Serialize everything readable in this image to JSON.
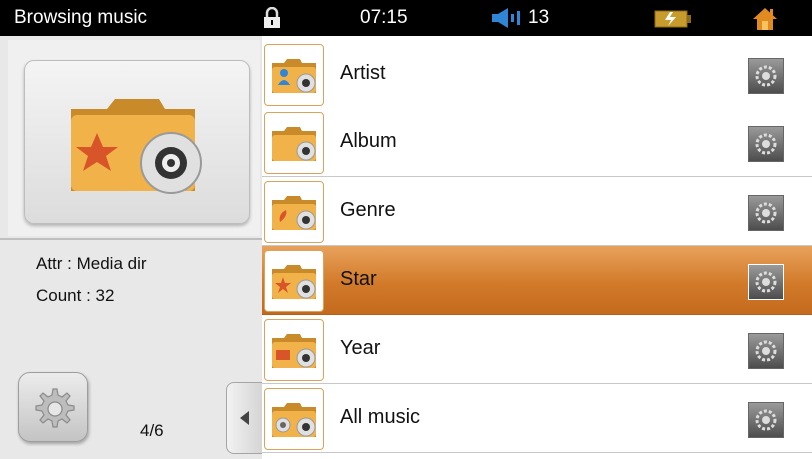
{
  "status_bar": {
    "title": "Browsing music",
    "time": "07:15",
    "volume": "13",
    "icons": [
      "lock-icon",
      "speaker-icon",
      "battery-icon",
      "home-icon"
    ]
  },
  "sidebar": {
    "attr": "Attr : Media dir",
    "count": "Count : 32",
    "page": "4/6",
    "art_icon": "star-music-folder-icon"
  },
  "list": {
    "items": [
      {
        "label": "Artist",
        "icon": "artist-folder-icon"
      },
      {
        "label": "Album",
        "icon": "album-folder-icon"
      },
      {
        "label": "Genre",
        "icon": "genre-folder-icon"
      },
      {
        "label": "Star",
        "icon": "star-folder-icon",
        "selected": true
      },
      {
        "label": "Year",
        "icon": "year-folder-icon"
      },
      {
        "label": "All music",
        "icon": "all-music-folder-icon"
      }
    ]
  },
  "colors": {
    "accent": "#d27a2a",
    "folder": "#e8a23c",
    "topbar": "#000000"
  }
}
